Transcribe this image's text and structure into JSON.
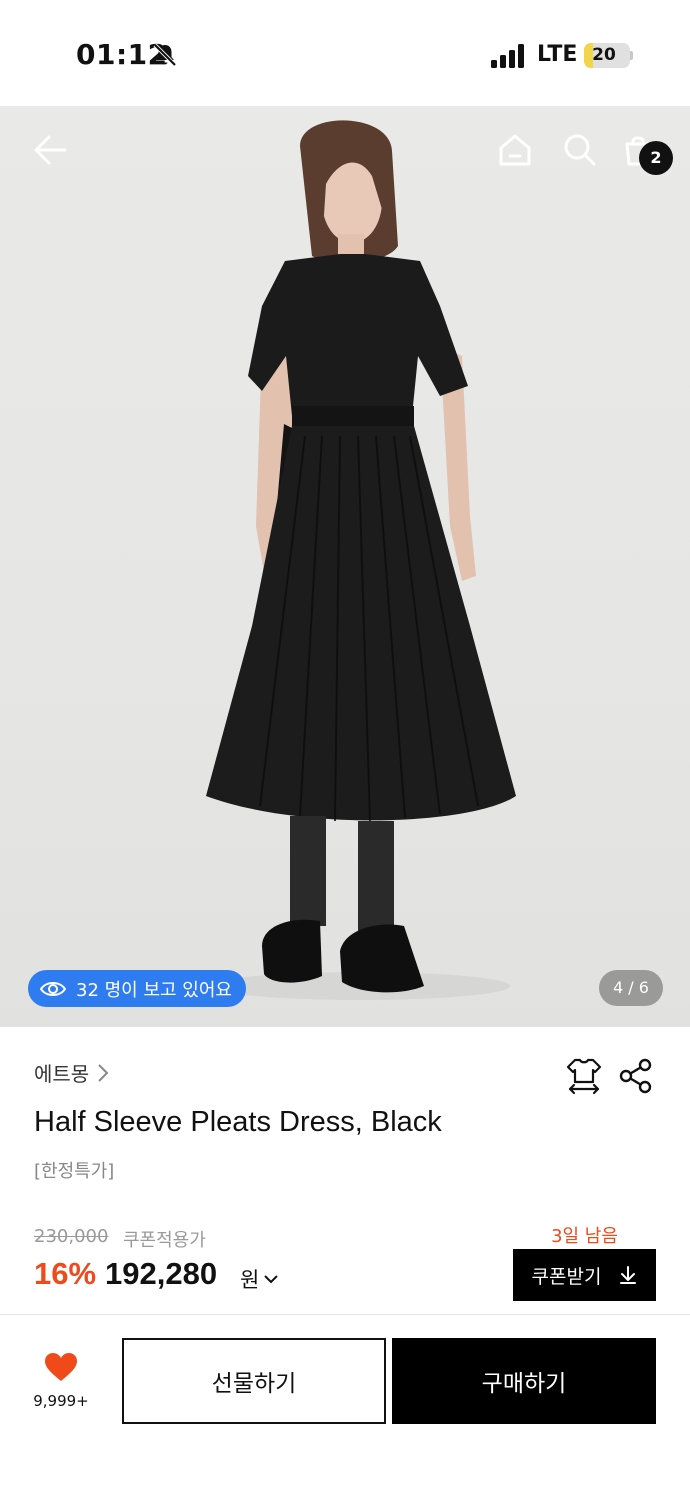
{
  "status_bar": {
    "time": "01:12",
    "network": "LTE",
    "battery_level": "20",
    "battery_fraction": 0.2,
    "icons": [
      "bell-slash-icon",
      "signal-icon"
    ]
  },
  "header": {
    "icons": [
      "back-arrow-icon",
      "home-icon",
      "search-icon",
      "shopping-bag-icon"
    ],
    "cart_count": "2"
  },
  "gallery": {
    "viewers_text": "32 명이 보고 있어요",
    "page_indicator": "4 / 6"
  },
  "product": {
    "brand": "에트몽",
    "title": "Half Sleeve Pleats Dress, Black",
    "tag": "[한정특가]",
    "original_price": "230,000",
    "coupon_note": "쿠폰적용가",
    "discount_rate": "16%",
    "sale_price": "192,280",
    "currency": "원",
    "days_left": "3일 남음",
    "coupon_button": "쿠폰받기"
  },
  "actions": {
    "like_count": "9,999+",
    "gift_label": "선물하기",
    "buy_label": "구매하기"
  },
  "colors": {
    "accent_orange": "#ee4a1b",
    "viewer_blue": "#2f7cf0",
    "heart_red": "#f04a1a",
    "black": "#000000"
  }
}
